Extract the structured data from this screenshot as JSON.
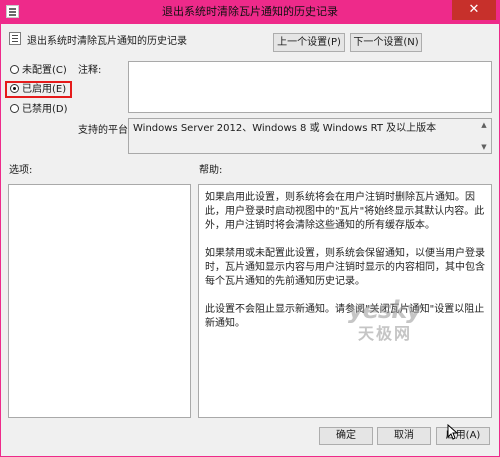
{
  "window": {
    "title": "退出系统时清除瓦片通知的历史记录",
    "close_symbol": "✕",
    "accent_color": "#ee2a8a"
  },
  "header": {
    "policy_name": "退出系统时清除瓦片通知的历史记录",
    "prev_button": "上一个设置(P)",
    "next_button": "下一个设置(N)"
  },
  "state": {
    "options": [
      {
        "label": "未配置(C)",
        "checked": false
      },
      {
        "label": "已启用(E)",
        "checked": true
      },
      {
        "label": "已禁用(D)",
        "checked": false
      }
    ]
  },
  "comment": {
    "label": "注释:",
    "value": ""
  },
  "platform": {
    "label": "支持的平台:",
    "value": "Windows Server 2012、Windows 8 或 Windows RT 及以上版本"
  },
  "sections": {
    "options_label": "选项:",
    "help_label": "帮助:"
  },
  "help": {
    "p1": "如果启用此设置，则系统将会在用户注销时删除瓦片通知。因此，用户登录时启动视图中的\"瓦片\"将始终显示其默认内容。此外，用户注销时将会清除这些通知的所有缓存版本。",
    "p2": "如果禁用或未配置此设置，则系统会保留通知，以便当用户登录时，瓦片通知显示内容与用户注销时显示的内容相同，其中包含每个瓦片通知的先前通知历史记录。",
    "p3": "此设置不会阻止显示新通知。请参阅\"关闭瓦片通知\"设置以阻止新通知。"
  },
  "watermark": {
    "top": "yesky",
    "bottom": "天极网"
  },
  "footer": {
    "ok": "确定",
    "cancel": "取消",
    "apply": "应用(A)"
  }
}
